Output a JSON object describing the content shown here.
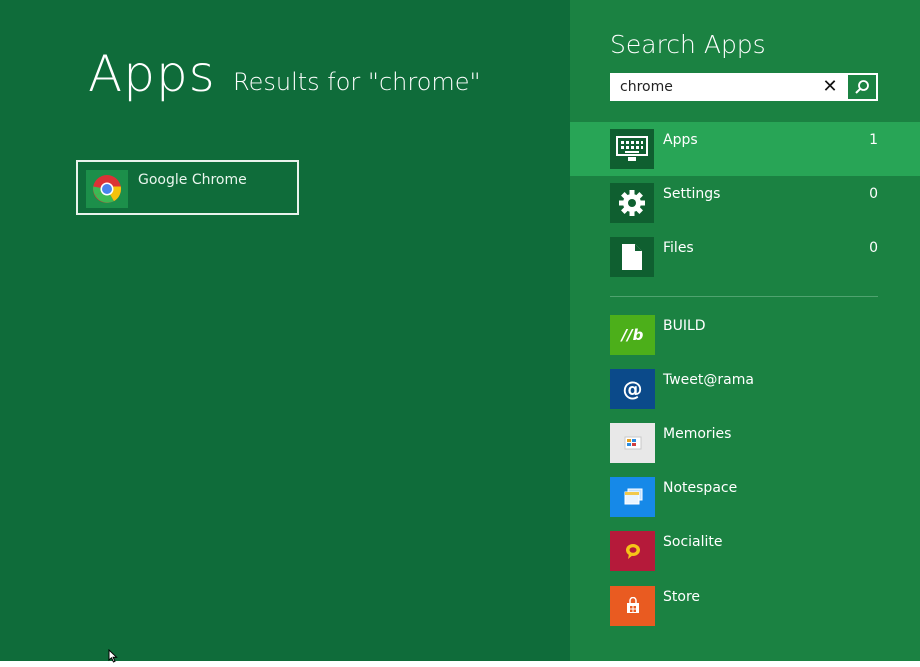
{
  "main": {
    "title": "Apps",
    "subtitle": "Results for \"chrome\"",
    "results": [
      {
        "label": "Google Chrome",
        "icon": "chrome-icon"
      }
    ]
  },
  "search_pane": {
    "title": "Search Apps",
    "query": "chrome",
    "clear_glyph": "✕",
    "categories": [
      {
        "label": "Apps",
        "count": "1",
        "icon": "keyboard-monitor-icon",
        "selected": true
      },
      {
        "label": "Settings",
        "count": "0",
        "icon": "gear-icon"
      },
      {
        "label": "Files",
        "count": "0",
        "icon": "file-icon"
      }
    ],
    "apps": [
      {
        "label": "BUILD",
        "icon": "build-icon",
        "color": "#4caf1a",
        "glyph": "//b"
      },
      {
        "label": "Tweet@rama",
        "icon": "at-sign-icon",
        "color": "#0b4a8a",
        "glyph": "@"
      },
      {
        "label": "Memories",
        "icon": "memories-icon",
        "color": "#e8e8e8"
      },
      {
        "label": "Notespace",
        "icon": "notespace-icon",
        "color": "#1689e8"
      },
      {
        "label": "Socialite",
        "icon": "socialite-icon",
        "color": "#b51a3a"
      },
      {
        "label": "Store",
        "icon": "shopping-bag-icon",
        "color": "#e95b21"
      }
    ]
  },
  "colors": {
    "left_bg": "#0f6c3a",
    "pane_bg": "#1b8242",
    "selected_bg": "#28a556"
  }
}
